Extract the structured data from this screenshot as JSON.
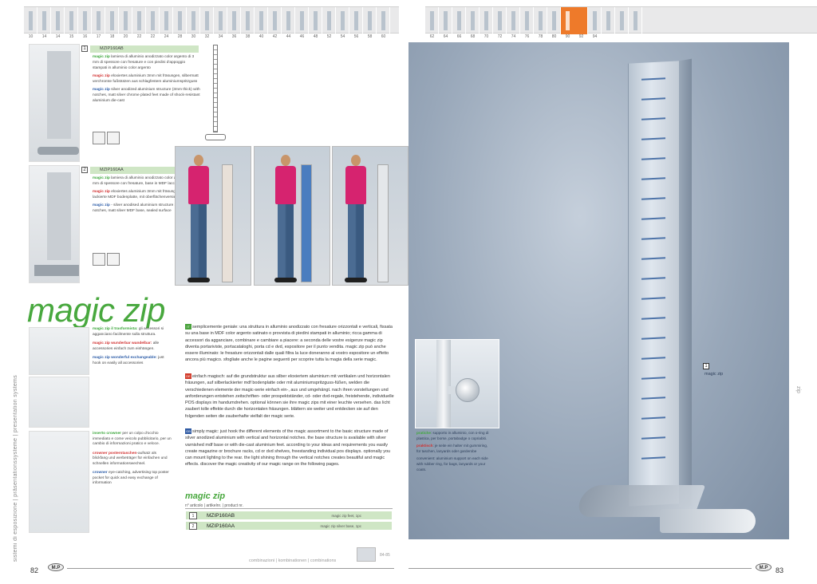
{
  "thumbnail_strip": {
    "numbers_left": [
      "10",
      "14",
      "14",
      "15",
      "16",
      "17",
      "18",
      "20",
      "22",
      "22",
      "24",
      "28",
      "30",
      "32",
      "34",
      "36",
      "38",
      "40",
      "42",
      "44",
      "46",
      "48",
      "52",
      "54",
      "56",
      "58",
      "60"
    ],
    "numbers_right": [
      "62",
      "64",
      "66",
      "68",
      "70",
      "72",
      "74",
      "76",
      "78",
      "80",
      "90",
      "92",
      "94"
    ],
    "selected_index_right": 9
  },
  "product1": {
    "number": "1",
    "code": "MZIP160AB",
    "it_lead": "magic zip",
    "it_text": " lamiera di alluminio anodizzato color argento di 3 mm di spessore con fresature e con piedini d'appoggio stampati in alluminio color argento",
    "de_lead": "magic zip",
    "de_text": " eloxiertes aluminium 3mm mit fräsungen, silbermatt verchromte fußstützen aus schlagfestem aluminiumspritzguss",
    "en_lead": "magic zip",
    "en_text": " silver anodized aluminium structure (3mm thick) with notches, matt silver chrome plated feet made of shock-resistant aluminium die-cast"
  },
  "product2": {
    "number": "2",
    "code": "MZIP160AA",
    "it_lead": "magic zip",
    "it_text": " lamiera di alluminio anodizzato color argento di 3 mm di spessore con fresature, base in MDF laccata argento.",
    "de_lead": "magic zip",
    "de_text": " eloxiertes aluminium 3mm mit fräsungen, silbermatt lackierte MDF bodenplatte, mit oberflächenversiegelung",
    "en_lead": "magic zip",
    "en_text": " - silver anodised aluminium structure 3mm with notches, matt silver MDF base, sealed surface"
  },
  "title": "magic zip",
  "side_text_left": "sistemi di esposizione | präsentationssysteme | presentation systems",
  "side_text_right": "zip",
  "accessories": {
    "a1_it_lead": "magic zip il trasformista:",
    "a1_it_text": " gli accessori si agganciano facilmente sulla struttura.",
    "a1_de_lead": "magic zip wunderbar wandelbar:",
    "a1_de_text": " alle accessories einfach zum einhängen.",
    "a1_en_lead": "magic zip wonderful exchangeable:",
    "a1_en_text": " just hook on easily all accessories",
    "a2_it_lead": "inserto crowner",
    "a2_it_text": " per un colpo d'occhio immediato e come veicolo pubblicitario, per un cambio di informazioni pratico e veloce.",
    "a2_de_lead": "crowner posterstaschen",
    "a2_de_text": "-aufsatz als blickfang und werbeträger für einfachen und schnellen informationswechsel.",
    "a2_en_lead": "crowner",
    "a2_en_text": " eye-catching, advertising top poster pocket for quick and easy exchange of information"
  },
  "body": {
    "it": "semplicemente geniale: una struttura in alluminio anodizzato con fresature orizzontali e verticali, fissata su una base in MDF color argento satinato o provvista di piedini stampati in alluminio; ricca gamma di accessori da agganciare, combinare e cambiare a piacere: a seconda delle vostre esigenze magic zip diventa portariviste, portacataloghi, porta cd e dvd, espositore per il punto vendita. magic zip può anche essere illuminato: le fresature orizzontali dalle quali filtra la luce doneranno al vostro espositore un effetto ancora più magico. sfogliate anche le pagine seguenti per scoprire tutta la magia della serie magic.",
    "de": "einfach magisch: auf die grundstruktur aus silber eloxiertem aluminium mit vertikalen und horizontalen fräsungen, auf silberlackierter mdf bodenplatte oder mit aluminiumspritzguss-füßen, welden die verschiedenen elemente der magic-serie einfach ein-, aus und umgehängt. nach ihren vorstellungen und anforderungen entstehen zeitschriften- oder prospektständer, cd- oder dvd-regale, freistehende, individuelle POS displays im handumdrehen. optional können sie ihre magic zips mit einer leuchte versehen. das licht zaubert tolle effekte durch die horizontalen fräsungen. blättern sie weiter und entdecken sie auf den folgenden seiten die zauberhafte vielfalt der magic serie.",
    "en": "simply magic: just hook the different elements of the magic assortment to the basic structure made of silver anodized aluminium with vertical and horizontal notches. the base structure is available with silver varnished mdf base or with die-cast aluminium feet. according to your ideas and requirements you easily create magazine or brochure racks, cd or dvd shelves, freestanding individual pos displays. optionally you can mount  lighting to the rear. the light shining through the vertical notches creates beautiful and magic effects. discover the magic creativity of our magic range on the following pages."
  },
  "table": {
    "title": "magic zip",
    "header": "n° articolo | artikelnr. | product nr.",
    "rows": [
      {
        "n": "1",
        "code": "MZIP160AB",
        "desc": "magic zip feet, 1pc"
      },
      {
        "n": "2",
        "code": "MZIP160AA",
        "desc": "magic zip silver base, 1pc"
      }
    ]
  },
  "footer": {
    "combo_text": "combinazioni | kombinationen | combinations",
    "combo_pages": "84-85",
    "page_left": "82",
    "page_right": "83",
    "logo": "M.P"
  },
  "inset": {
    "it_lead": "pratiche",
    "it_text": ": supporto in alluminio, con o-ring di plastica, per borse, portabadge o copriabiti.",
    "de_lead": "praktisch",
    "de_text": ": je seite ein halter mit gummiring, für taschen, lanyards oder garderobe",
    "en_text": "convenient: aluminium support on each side with rubber ring, for bags, lanyards or your coats."
  },
  "bigphoto_tag": {
    "number": "1",
    "label": "magic zip"
  },
  "colors": {
    "brand_green": "#48a83e",
    "highlight_green": "#cfe6c5",
    "selected_orange": "#ee7a2a"
  }
}
